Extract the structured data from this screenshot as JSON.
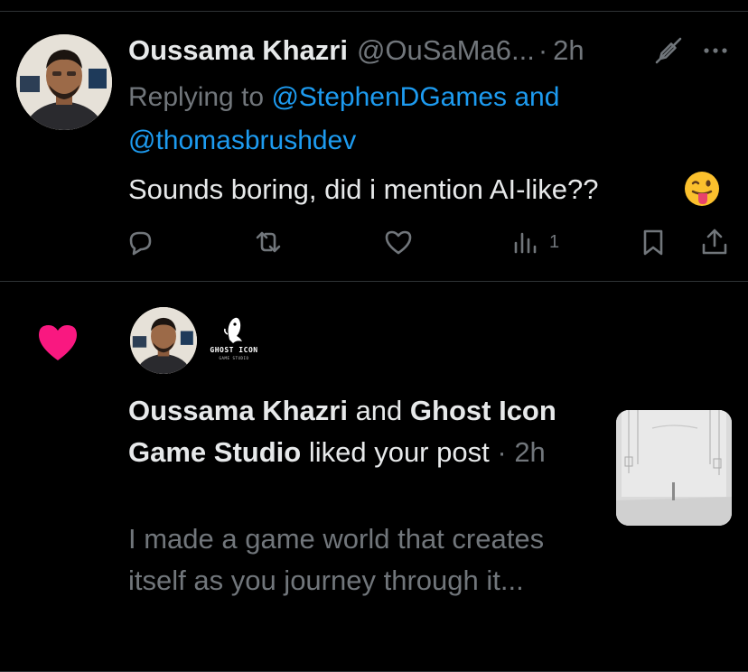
{
  "reply": {
    "author_name": "Oussama Khazri",
    "author_handle": "@OuSaMa6...",
    "time": "2h",
    "replying_prefix": "Replying to",
    "mention1": "@StephenDGames",
    "and_word": "and",
    "mention2": "@thomasbrushdev",
    "text": "Sounds boring, did i mention AI-like??",
    "emoji": "winking-face-with-tongue",
    "views_count": "1",
    "icons": [
      "edit-off-icon",
      "more-icon",
      "reply-icon",
      "retweet-icon",
      "like-icon",
      "views-icon",
      "bookmark-icon",
      "share-icon"
    ]
  },
  "notification": {
    "icon": "heart-icon",
    "user1": "Oussama Khazri",
    "and_word": "and",
    "user2": "Ghost Icon Game Studio",
    "action": "liked your",
    "object": "post",
    "time": "2h",
    "preview": "I made a game world that creates itself as you journey through it...",
    "avatar2_label": "GHOST ICON",
    "avatar2_sub": "GAME STUDIO",
    "accent_color": "#f91880"
  },
  "colors": {
    "background": "#000000",
    "text": "#e7e9ea",
    "muted": "#71767b",
    "link": "#1d9bf0",
    "like": "#f91880"
  }
}
